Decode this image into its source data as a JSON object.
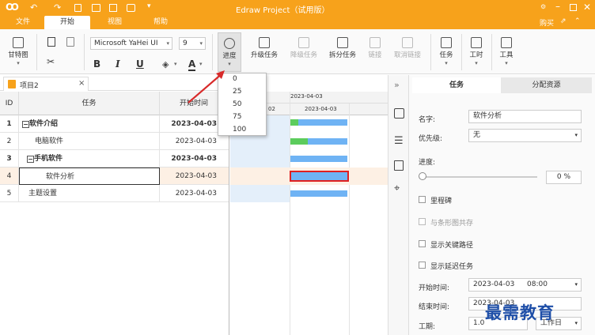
{
  "app": {
    "title": "Edraw Project（试用版）",
    "buy": "购买",
    "brand_color": "#f7a21b"
  },
  "menu": {
    "file": "文件",
    "start": "开始",
    "view": "视图",
    "help": "帮助"
  },
  "ribbon": {
    "gantt": "甘特图",
    "font": "Microsoft YaHei UI",
    "size": "9",
    "bold": "B",
    "italic": "I",
    "underline": "U",
    "fontcolor": "A",
    "progress": "进度",
    "upgrade": "升级任务",
    "downgrade": "降级任务",
    "split": "拆分任务",
    "link": "链接",
    "unlink": "取消链接",
    "task": "任务",
    "worktime": "工时",
    "tools": "工具"
  },
  "doc": {
    "tab": "项目2",
    "close": "×"
  },
  "grid": {
    "headers": {
      "id": "ID",
      "task": "任务",
      "start": "开始时间"
    },
    "rows": [
      {
        "id": "1",
        "task": "软件介绍",
        "start": "2023-04-03"
      },
      {
        "id": "2",
        "task": "电脑软件",
        "start": "2023-04-03"
      },
      {
        "id": "3",
        "task": "手机软件",
        "start": "2023-04-03"
      },
      {
        "id": "4",
        "task": "软件分析",
        "start": "2023-04-03"
      },
      {
        "id": "5",
        "task": "主题设置",
        "start": "2023-04-03"
      }
    ]
  },
  "gantt": {
    "date_top": "2023-04-03",
    "col_left": "02",
    "col_mid": "2023-04-03"
  },
  "dropdown": {
    "items": [
      "0",
      "25",
      "50",
      "75",
      "100"
    ]
  },
  "panel": {
    "tab_task": "任务",
    "tab_resource": "分配资源",
    "name_label": "名字:",
    "name_value": "软件分析",
    "priority_label": "优先级:",
    "priority_value": "无",
    "progress_label": "进度:",
    "progress_value": "0 %",
    "milestone": "里程碑",
    "coexist": "与条形图共存",
    "critical": "显示关键路径",
    "delay": "显示延迟任务",
    "start_label": "开始时间:",
    "start_date": "2023-04-03",
    "start_time": "08:00",
    "end_label": "结束时间:",
    "end_date": "2023-04-03",
    "duration_label": "工期:",
    "duration_value": "1.0",
    "duration_unit": "工作日"
  },
  "watermark": "最需教育"
}
